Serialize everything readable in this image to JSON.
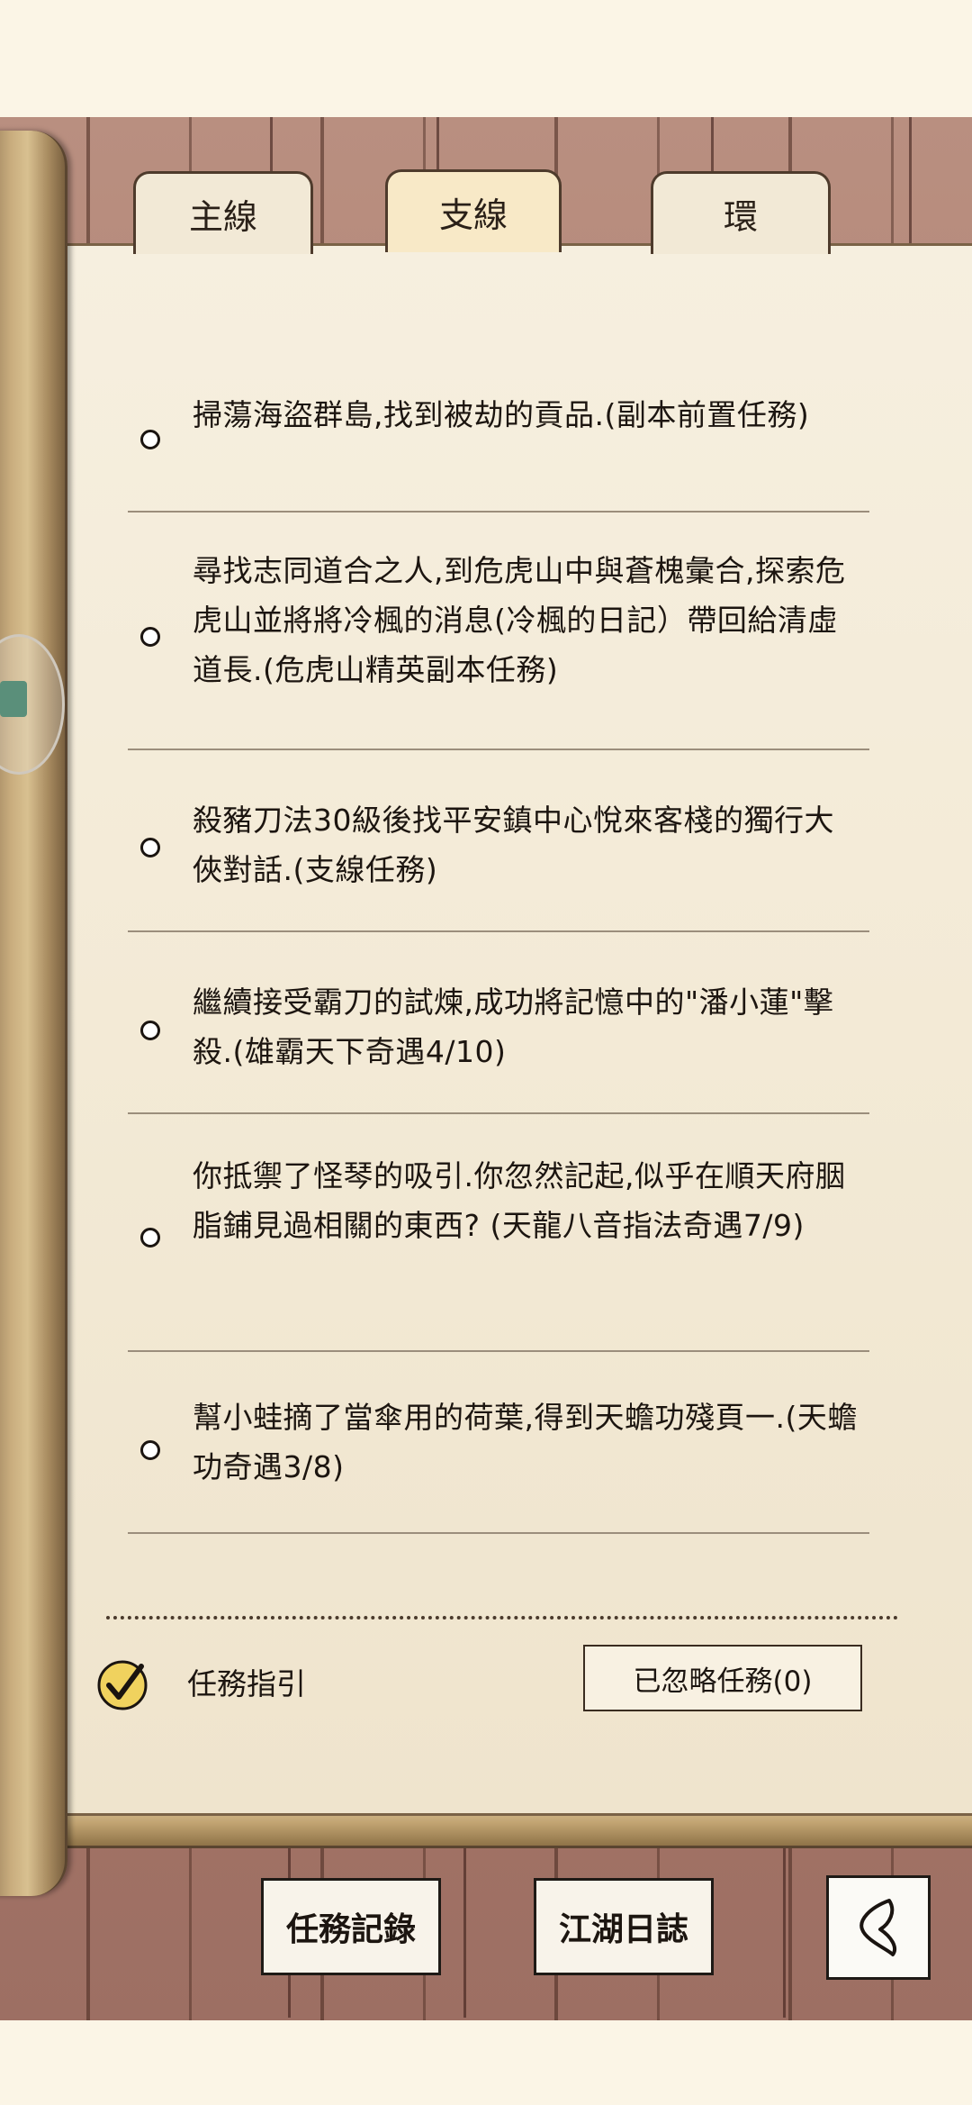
{
  "tabs": [
    {
      "label": "主線",
      "active": false
    },
    {
      "label": "支線",
      "active": true
    },
    {
      "label": "環",
      "active": false
    }
  ],
  "quests": [
    {
      "text": "掃蕩海盜群島,找到被劫的貢品.(副本前置任務)"
    },
    {
      "text": "尋找志同道合之人,到危虎山中與蒼槐彙合,探索危虎山並將將冷楓的消息(冷楓的日記）帶回給清虛道長.(危虎山精英副本任務)"
    },
    {
      "text": "殺豬刀法30級後找平安鎮中心悅來客棧的獨行大俠對話.(支線任務)"
    },
    {
      "text": "繼續接受霸刀的試煉,成功將記憶中的\"潘小蓮\"擊殺.(雄霸天下奇遇4/10)"
    },
    {
      "text": "你抵禦了怪琴的吸引.你忽然記起,似乎在順天府胭脂鋪見過相關的東西? (天龍八音指法奇遇7/9)"
    },
    {
      "text": "幫小蛙摘了當傘用的荷葉,得到天蟾功殘頁一.(天蟾功奇遇3/8)"
    }
  ],
  "guide": {
    "label": "任務指引",
    "checked": true
  },
  "ignored_button": "已忽略任務(0)",
  "nav": {
    "records": "任務記錄",
    "journal": "江湖日誌"
  },
  "icons": {
    "back": "back-arrow-icon",
    "check": "checkmark-icon"
  }
}
